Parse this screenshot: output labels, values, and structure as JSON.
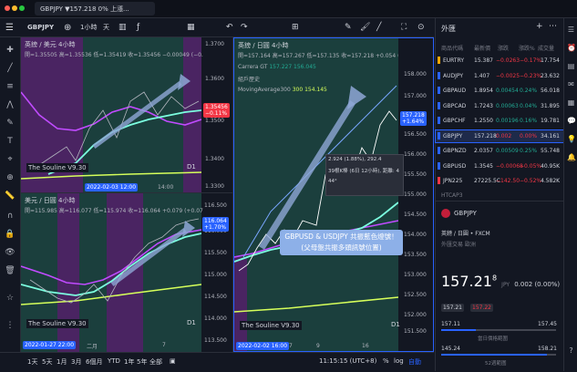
{
  "tabs": {
    "main": "GBPJPY ▼157.218 0% 上漲...",
    "price_short": "157.218",
    "partial": "Les..."
  },
  "toolbar": {
    "symbol": "GBPJPY",
    "interval": "1小時",
    "day": "天"
  },
  "chart1": {
    "title": "英鎊 / 美元 4小時",
    "prices": "開=1.35505 高=1.35536 低=1.35419 收=1.35456 −0.00049 (−0.04%)",
    "axis": [
      "1.3700",
      "1.3600",
      "1.3500",
      "1.3400",
      "1.3300"
    ],
    "badge_price": "1.35456",
    "badge_pct": "−0.11%",
    "indicator": "The Souline V9.30",
    "date_badge": "2022-02-03 12:00",
    "xlabels": [
      "14:00"
    ],
    "d1": "D1"
  },
  "chart2": {
    "title": "英鎊 / 日圓 4小時",
    "prices": "開=157.164 高=157.267 低=157.135 收=157.218 +0.054 (+0.03%)",
    "cg_label": "Carrera GT",
    "cg_values": "157.227 156.045",
    "history": "組戶歷史",
    "ma_label": "MovingAverage300",
    "ma_values": "300 154.145",
    "axis": [
      "158.000",
      "157.000",
      "156.500",
      "156.000",
      "155.500",
      "155.000",
      "154.500",
      "154.000",
      "153.500",
      "153.000",
      "152.500",
      "152.000",
      "151.500",
      "151.000"
    ],
    "badge_price": "157.218",
    "badge_pct": "+1.64%",
    "measure_line1": "2.924 (1.88%), 292.4",
    "measure_line2": "39根K棒 (6日 12小時), 距離: 4",
    "measure_line3": "44°",
    "annotation_line1": "GBPUSD & USDJPY 共振藍色燈號！",
    "annotation_line2": "(父母盤共振多頭訊號位置)",
    "indicator": "The Souline V9.30",
    "date_badge": "2022-02-02 16:00",
    "xlabels": [
      "7",
      "9",
      "16"
    ],
    "d1": "D1"
  },
  "chart3": {
    "title": "美元 / 日圓 4小時",
    "prices": "開=115.985 高=116.077 低=115.974 收=116.064 +0.079 (+0.07%)",
    "axis": [
      "116.500",
      "116.000",
      "115.500",
      "115.000",
      "114.500",
      "114.000",
      "113.500"
    ],
    "badge_price": "116.064",
    "badge_pct": "+1.70%",
    "indicator": "The Souline V9.30",
    "date_badge": "2022-01-27 22:00",
    "xlabels": [
      "二月",
      "7"
    ],
    "d1": "D1"
  },
  "bottom": {
    "ranges": [
      "1天",
      "5天",
      "1月",
      "3月",
      "6個月",
      "YTD",
      "1年",
      "5年",
      "全部"
    ],
    "time": "11:15:15 (UTC+8)",
    "pct": "%",
    "log": "log",
    "auto": "自動"
  },
  "watchlist": {
    "title": "外匯",
    "headers": [
      "商品代碼",
      "最新價",
      "漲跌",
      "漲跌%",
      "成交量"
    ],
    "rows": [
      {
        "color": "#f7a600",
        "symbol": "EURTRY",
        "last": "15.387",
        "chg": "−0.0263",
        "chgp": "−0.17%",
        "vol": "17.754",
        "dir": "neg"
      },
      {
        "color": "#2962ff",
        "symbol": "AUDJPY",
        "last": "1.407",
        "chg": "−0.0025",
        "chgp": "−0.23%",
        "vol": "23.632",
        "dir": "neg"
      },
      {
        "color": "#2962ff",
        "symbol": "GBPAUD",
        "last": "1.8954",
        "chg": "0.00454",
        "chgp": "0.24%",
        "vol": "56.018",
        "dir": "pos"
      },
      {
        "color": "#2962ff",
        "symbol": "GBPCAD",
        "last": "1.7243",
        "chg": "0.00063",
        "chgp": "0.04%",
        "vol": "31.895",
        "dir": "pos"
      },
      {
        "color": "#2962ff",
        "symbol": "GBPCHF",
        "last": "1.2550",
        "chg": "0.00196",
        "chgp": "0.16%",
        "vol": "19.781",
        "dir": "pos"
      },
      {
        "color": "#2962ff",
        "symbol": "GBPJPY",
        "last": "157.218",
        "chg": "0.002",
        "chgp": "0.00%",
        "vol": "34.161",
        "dir": "neg"
      },
      {
        "color": "#2962ff",
        "symbol": "GBPNZD",
        "last": "2.0357",
        "chg": "0.00509",
        "chgp": "0.25%",
        "vol": "55.748",
        "dir": "pos"
      },
      {
        "color": "#2962ff",
        "symbol": "GBPUSD",
        "last": "1.3545",
        "chg": "−0.00068",
        "chgp": "−0.05%",
        "vol": "40.95K",
        "dir": "neg"
      },
      {
        "color": "#f23645",
        "symbol": "JPN225",
        "last": "27225.5C",
        "chg": "−142.50",
        "chgp": "−0.52%",
        "vol": "4.582K",
        "dir": "neg"
      }
    ],
    "partial_row": "HTCAP3",
    "detail_symbol": "GBPJPY",
    "detail_name": "英鎊 / 日圓 • FXCM",
    "detail_type": "外匯交易  歐洲",
    "detail_price": "157.21",
    "detail_price_sup": "8",
    "detail_unit": "JPY",
    "detail_change": "0.002 (0.00%)",
    "detail_chip1": "157.21",
    "detail_chip2": "157.22",
    "day_low": "157.11",
    "day_high": "157.45",
    "day_label": "當日價格範圍",
    "wk_low": "145.24",
    "wk_high": "158.21",
    "wk_label": "52週範圍"
  },
  "colors": {
    "accent": "#2962ff",
    "up": "#22ab94",
    "down": "#f23645",
    "purple_band": "#5b2a76",
    "teal_band": "#1f5a55"
  }
}
